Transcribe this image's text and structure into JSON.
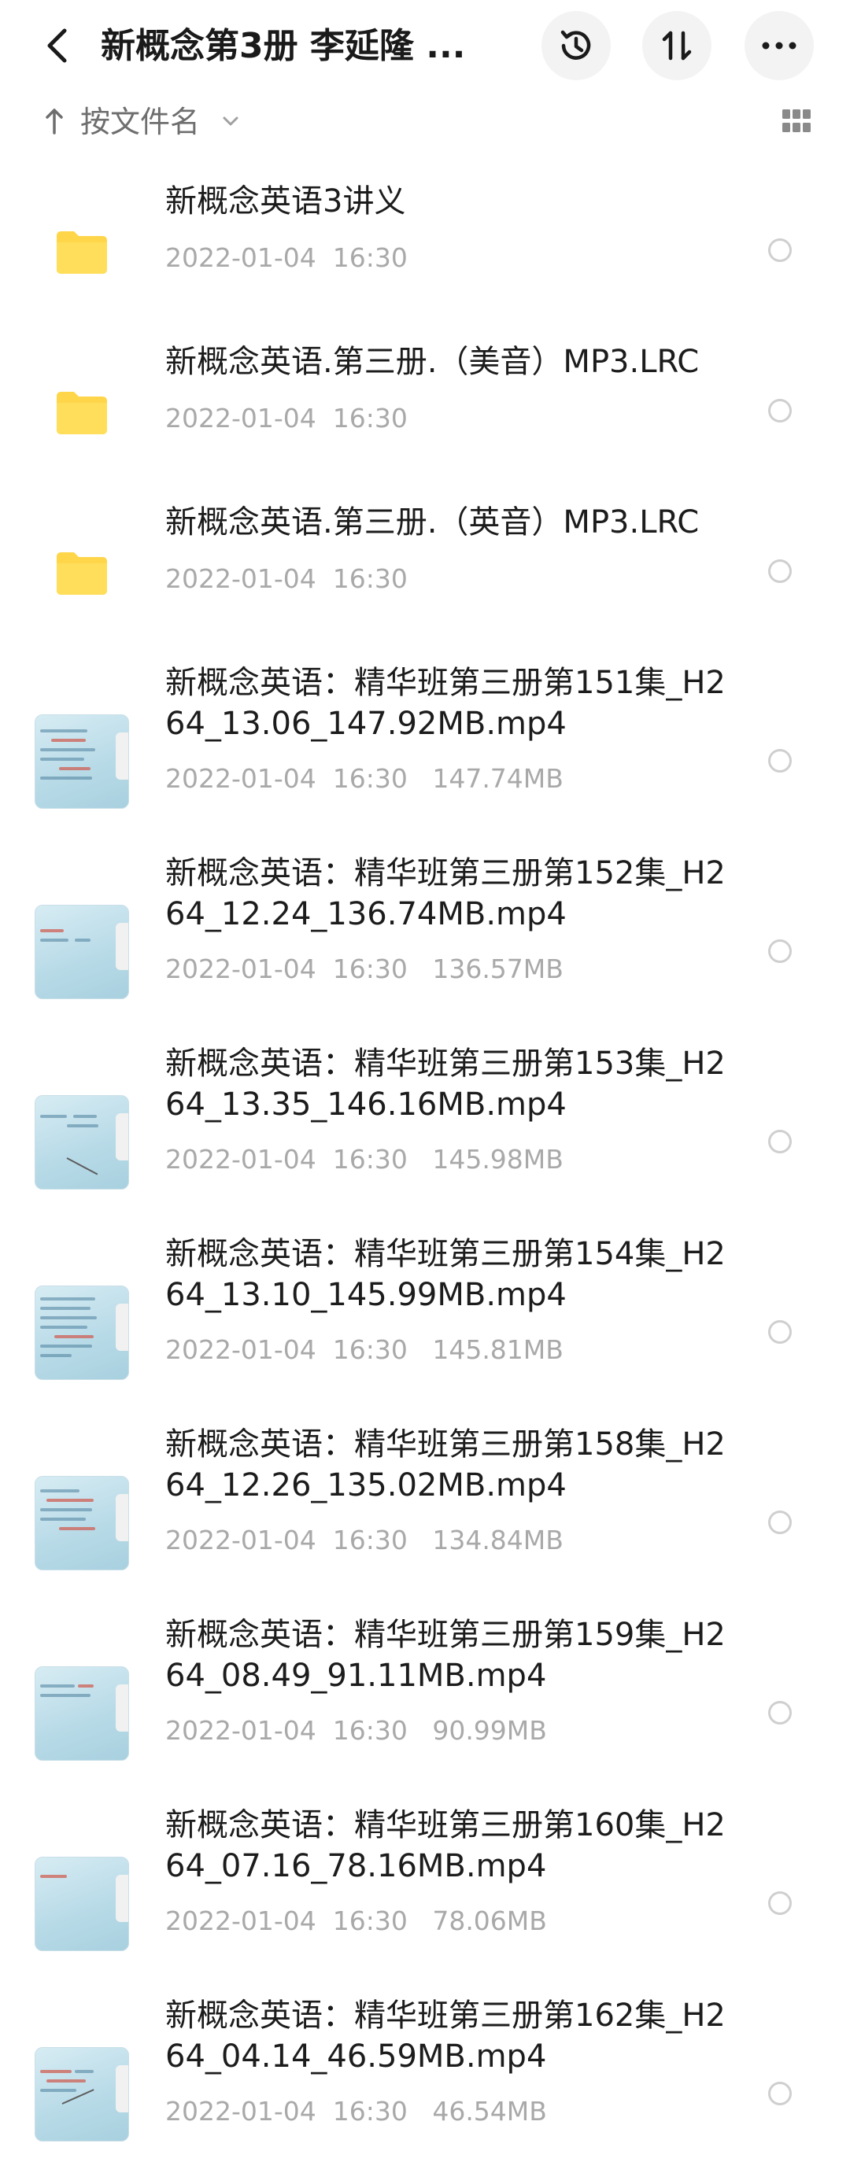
{
  "header": {
    "title": "新概念第3册 李延隆 ...",
    "back_icon": "back-chevron-icon",
    "history_icon": "history-clock-icon",
    "transfer_icon": "transfer-arrows-icon",
    "more_icon": "more-dots-icon"
  },
  "sortbar": {
    "label": "按文件名",
    "arrow_icon": "sort-up-arrow-icon",
    "chevron_icon": "chevron-down-icon",
    "view_icon": "grid-view-icon"
  },
  "colors": {
    "folder": "#FFD54A",
    "folder_tab": "#FFC53D",
    "meta_text": "#A9A9A9",
    "title_text": "#1A1A1A"
  },
  "files": [
    {
      "type": "folder",
      "name": "新概念英语3讲义",
      "meta": "2022-01-04  16:30"
    },
    {
      "type": "folder",
      "name": "新概念英语.第三册.（美音）MP3.LRC",
      "meta": "2022-01-04  16:30"
    },
    {
      "type": "folder",
      "name": "新概念英语.第三册.（英音）MP3.LRC",
      "meta": "2022-01-04  16:30"
    },
    {
      "type": "video",
      "name": "新概念英语：精华班第三册第151集_H264_13.06_147.92MB.mp4",
      "meta": "2022-01-04  16:30   147.74MB"
    },
    {
      "type": "video",
      "name": "新概念英语：精华班第三册第152集_H264_12.24_136.74MB.mp4",
      "meta": "2022-01-04  16:30   136.57MB"
    },
    {
      "type": "video",
      "name": "新概念英语：精华班第三册第153集_H264_13.35_146.16MB.mp4",
      "meta": "2022-01-04  16:30   145.98MB"
    },
    {
      "type": "video",
      "name": "新概念英语：精华班第三册第154集_H264_13.10_145.99MB.mp4",
      "meta": "2022-01-04  16:30   145.81MB"
    },
    {
      "type": "video",
      "name": "新概念英语：精华班第三册第158集_H264_12.26_135.02MB.mp4",
      "meta": "2022-01-04  16:30   134.84MB"
    },
    {
      "type": "video",
      "name": "新概念英语：精华班第三册第159集_H264_08.49_91.11MB.mp4",
      "meta": "2022-01-04  16:30   90.99MB"
    },
    {
      "type": "video",
      "name": "新概念英语：精华班第三册第160集_H264_07.16_78.16MB.mp4",
      "meta": "2022-01-04  16:30   78.06MB"
    },
    {
      "type": "video",
      "name": "新概念英语：精华班第三册第162集_H264_04.14_46.59MB.mp4",
      "meta": "2022-01-04  16:30   46.54MB"
    }
  ]
}
